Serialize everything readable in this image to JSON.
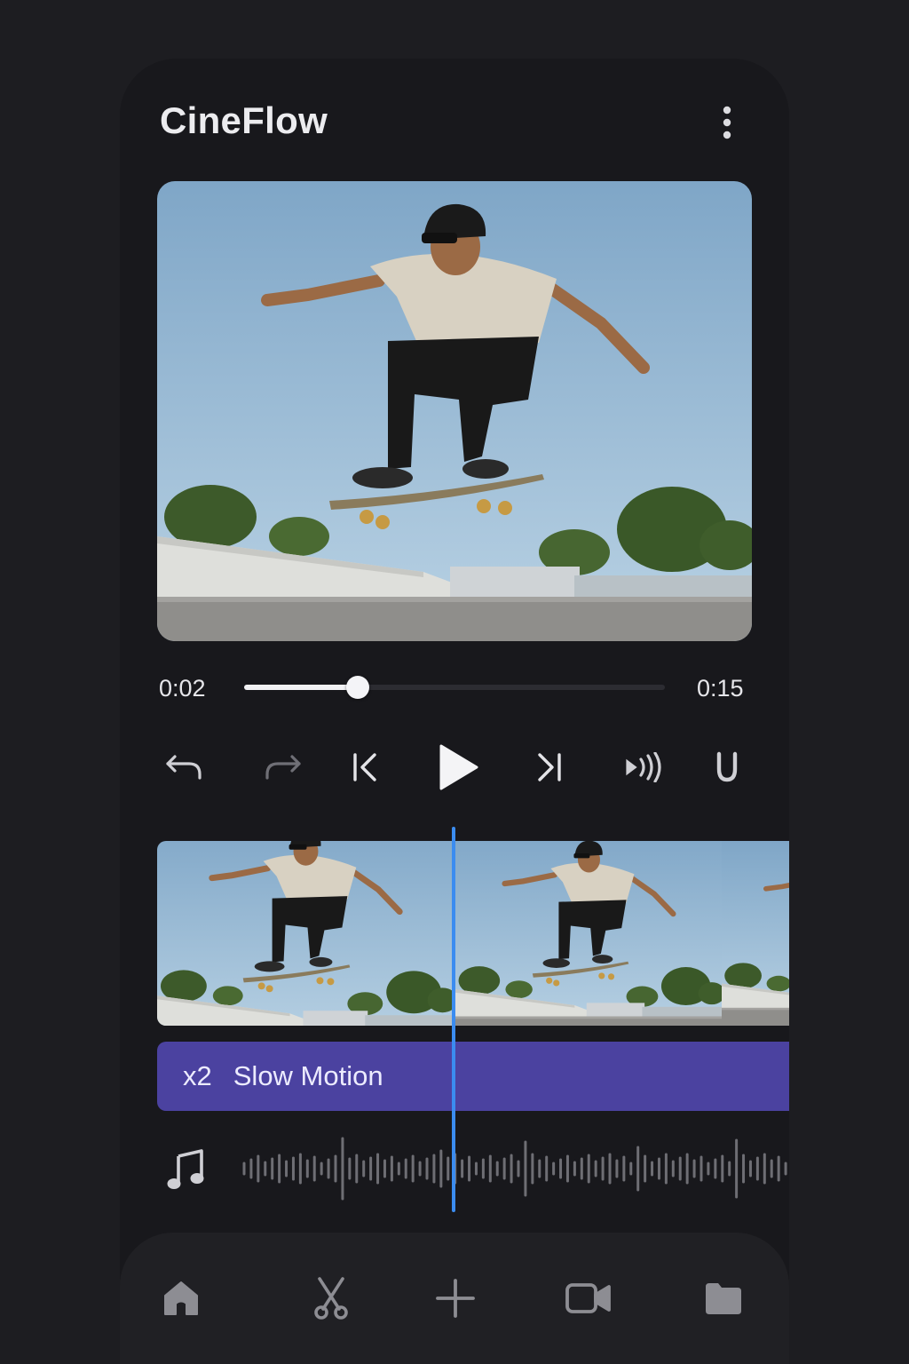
{
  "app": {
    "title": "CineFlow"
  },
  "header": {
    "menu_icon": "more-vertical-icon"
  },
  "preview": {
    "subject": "skateboarder-photo"
  },
  "playback": {
    "current_time": "0:02",
    "total_time": "0:15",
    "progress": 0.27
  },
  "controls": [
    {
      "name": "undo-icon"
    },
    {
      "name": "redo-icon"
    },
    {
      "name": "skip-back-icon"
    },
    {
      "name": "play-icon"
    },
    {
      "name": "skip-forward-icon"
    },
    {
      "name": "volume-icon"
    },
    {
      "name": "magnet-icon"
    }
  ],
  "timeline": {
    "effect": {
      "multiplier": "x2",
      "label": "Slow Motion",
      "color": "#4b42a0"
    },
    "audio_icon": "music-note-icon",
    "playhead_color": "#3b8cf0"
  },
  "nav": [
    {
      "name": "home-icon"
    },
    {
      "name": "scissors-icon"
    },
    {
      "name": "plus-icon"
    },
    {
      "name": "video-camera-icon"
    },
    {
      "name": "folder-icon"
    }
  ]
}
